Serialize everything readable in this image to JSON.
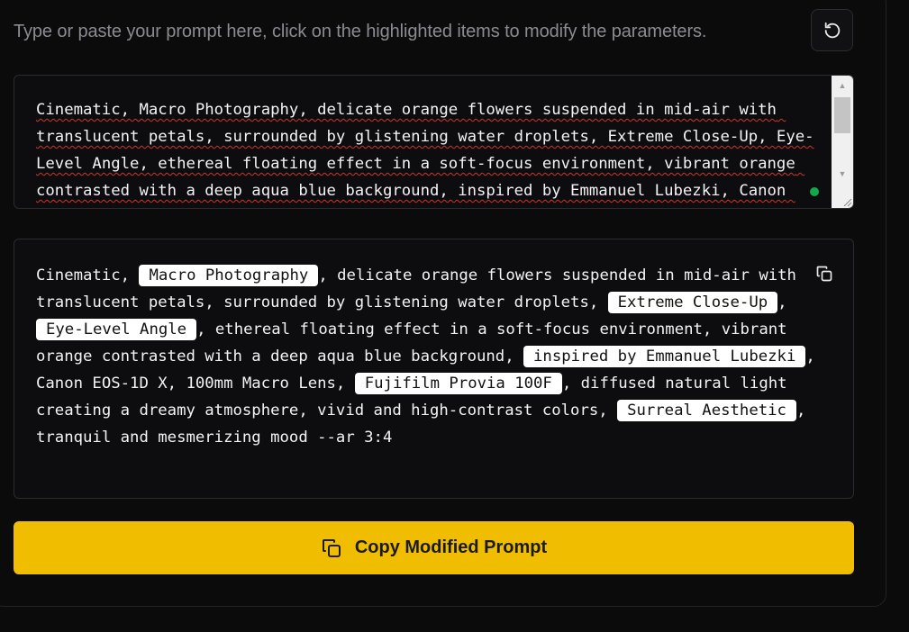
{
  "instruction": "Type or paste your prompt here, click on the highlighted items to modify the parameters.",
  "editor": {
    "text": "Cinematic, Macro Photography, delicate orange flowers suspended in mid-air with translucent petals, surrounded by glistening water droplets, Extreme Close-Up, Eye-Level Angle, ethereal floating effect in a soft-focus environment, vibrant orange contrasted with a deep aqua blue background, inspired by Emmanuel Lubezki, Canon EOS-1D X, 100mm Macro Lens, Fujifilm Provia 100F, diffused natural light creating a dreamy atmosphere, vivid and high-contrast colors, Surreal Aesthetic, tranquil and mesmerizing mood --ar 3:4",
    "status_color": "#13a84b"
  },
  "preview": {
    "segments": [
      {
        "text": "Cinematic, ",
        "highlight": false
      },
      {
        "text": "Macro Photography",
        "highlight": true
      },
      {
        "text": ", delicate orange flowers suspended in mid-air with translucent petals, surrounded by glistening water droplets, ",
        "highlight": false
      },
      {
        "text": "Extreme Close-Up",
        "highlight": true
      },
      {
        "text": ", ",
        "highlight": false
      },
      {
        "text": "Eye-Level Angle",
        "highlight": true
      },
      {
        "text": ", ethereal floating effect in a soft-focus environment, vibrant orange contrasted with a deep aqua blue background, ",
        "highlight": false
      },
      {
        "text": "inspired by Emmanuel Lubezki",
        "highlight": true
      },
      {
        "text": ", Canon EOS-1D X, 100mm Macro Lens, ",
        "highlight": false
      },
      {
        "text": "Fujifilm Provia 100F",
        "highlight": true
      },
      {
        "text": ", diffused natural light creating a dreamy atmosphere, vivid and high-contrast colors, ",
        "highlight": false
      },
      {
        "text": "Surreal Aesthetic",
        "highlight": true
      },
      {
        "text": ", tranquil and mesmerizing mood --ar 3:4",
        "highlight": false
      }
    ]
  },
  "icons": {
    "reset": "reset-icon",
    "copy": "copy-icon"
  },
  "copy_button": {
    "label": "Copy Modified Prompt"
  },
  "colors": {
    "accent": "#f0bd00",
    "background": "#0b0b0c",
    "highlight_bg": "#ffffff"
  }
}
